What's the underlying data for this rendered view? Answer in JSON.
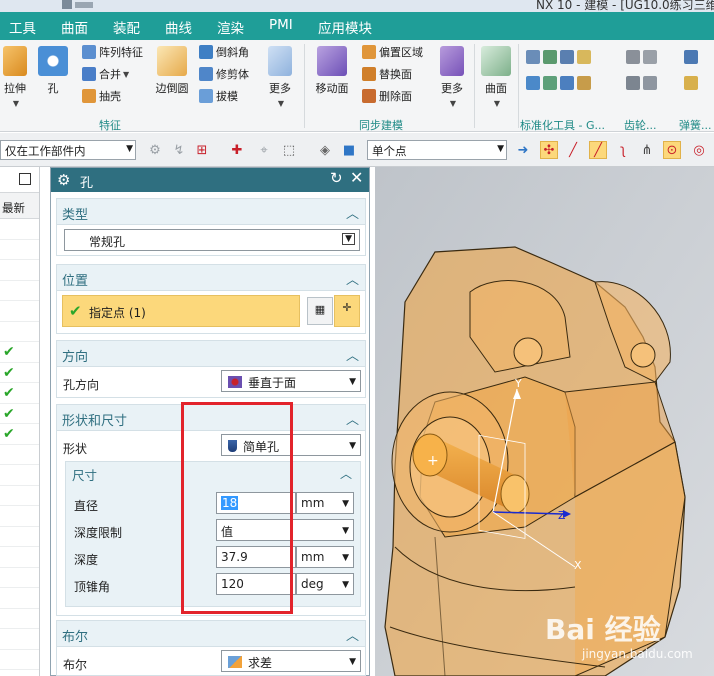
{
  "window": {
    "title_text": "NX 10 - 建模 - [UG10.0练习三维..."
  },
  "menubar": {
    "items": [
      "工具",
      "曲面",
      "装配",
      "曲线",
      "渲染",
      "PMI",
      "应用模块"
    ]
  },
  "ribbon": {
    "feature_group": {
      "label": "特征",
      "extrude": "拉伸",
      "hole": "孔",
      "pattern_feature": "阵列特征",
      "unite": "合并",
      "shell": "抽壳",
      "edge_blend": "边倒圆",
      "chamfer": "倒斜角",
      "trim_body": "修剪体",
      "draft": "拔模",
      "more": "更多"
    },
    "sync_group": {
      "label": "同步建模",
      "move_face": "移动面",
      "offset_region": "偏置区域",
      "replace_face": "替换面",
      "delete_face": "删除面",
      "more": "更多"
    },
    "surface_group": {
      "surface": "曲面"
    },
    "standard_group": {
      "label": "标准化工具 - G..."
    },
    "gear_group": {
      "label": "齿轮..."
    },
    "spring_group": {
      "label": "弹簧..."
    }
  },
  "toolbar": {
    "scope_combo": "仅在工作部件内",
    "snap_combo": "单个点"
  },
  "left_panel": {
    "column_header": "最新",
    "check_rows": [
      6,
      7,
      8,
      9,
      10
    ]
  },
  "dialog": {
    "title": "孔",
    "type_section": {
      "label": "类型",
      "value": "常规孔"
    },
    "position_section": {
      "label": "位置",
      "specify_point": "指定点 (1)"
    },
    "direction_section": {
      "label": "方向",
      "row_label": "孔方向",
      "value": "垂直于面"
    },
    "form_section": {
      "label": "形状和尺寸",
      "shape_label": "形状",
      "shape_value": "简单孔",
      "dimensions": {
        "label": "尺寸",
        "diameter_label": "直径",
        "diameter_value": "18",
        "diameter_unit": "mm",
        "depth_limit_label": "深度限制",
        "depth_limit_value": "值",
        "depth_label": "深度",
        "depth_value": "37.9",
        "depth_unit": "mm",
        "tip_angle_label": "顶锥角",
        "tip_angle_value": "120",
        "tip_angle_unit": "deg"
      }
    },
    "boolean_section": {
      "label": "布尔",
      "row_label": "布尔",
      "value": "求差"
    }
  },
  "viewport": {
    "axis_labels": {
      "x": "X",
      "y": "Y",
      "z": "Z"
    },
    "watermark": "Bai 经验",
    "watermark_sub": "jingyan.baidu.com"
  },
  "colors": {
    "menubar": "#1f9e98",
    "dialog_header": "#2f6f80",
    "point_highlight": "#fcd87b",
    "annotation_red": "#e2232b",
    "part_orange": "#f2a23a"
  }
}
